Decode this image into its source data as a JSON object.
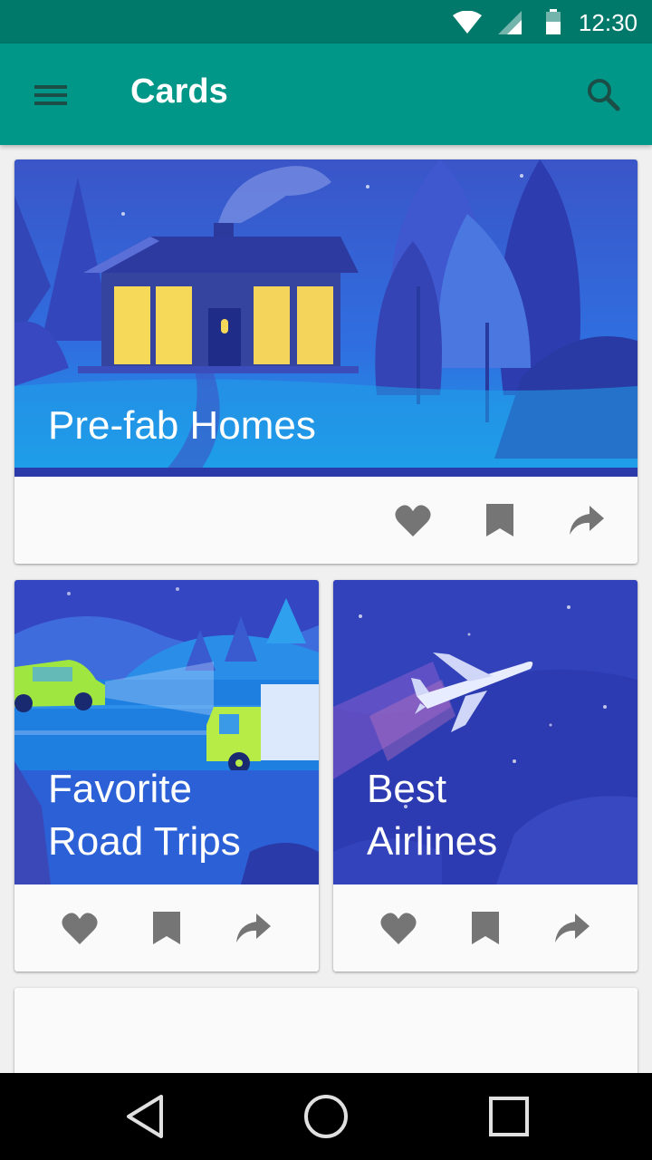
{
  "status_bar": {
    "time": "12:30",
    "icons": [
      "wifi-icon",
      "cell-signal-icon",
      "battery-icon"
    ]
  },
  "app_bar": {
    "title": "Cards",
    "icons": [
      "menu-icon",
      "search-icon"
    ],
    "color": "#009688",
    "status_color": "#00796b"
  },
  "cards": [
    {
      "title": "Pre-fab Homes",
      "actions": [
        "heart-icon",
        "bookmark-icon",
        "share-icon"
      ]
    },
    {
      "title_line1": "Favorite",
      "title_line2": "Road Trips",
      "actions": [
        "heart-icon",
        "bookmark-icon",
        "share-icon"
      ]
    },
    {
      "title_line1": "Best",
      "title_line2": "Airlines",
      "actions": [
        "heart-icon",
        "bookmark-icon",
        "share-icon"
      ]
    }
  ],
  "nav_bar": {
    "icons": [
      "back-icon",
      "home-icon",
      "recents-icon"
    ]
  }
}
